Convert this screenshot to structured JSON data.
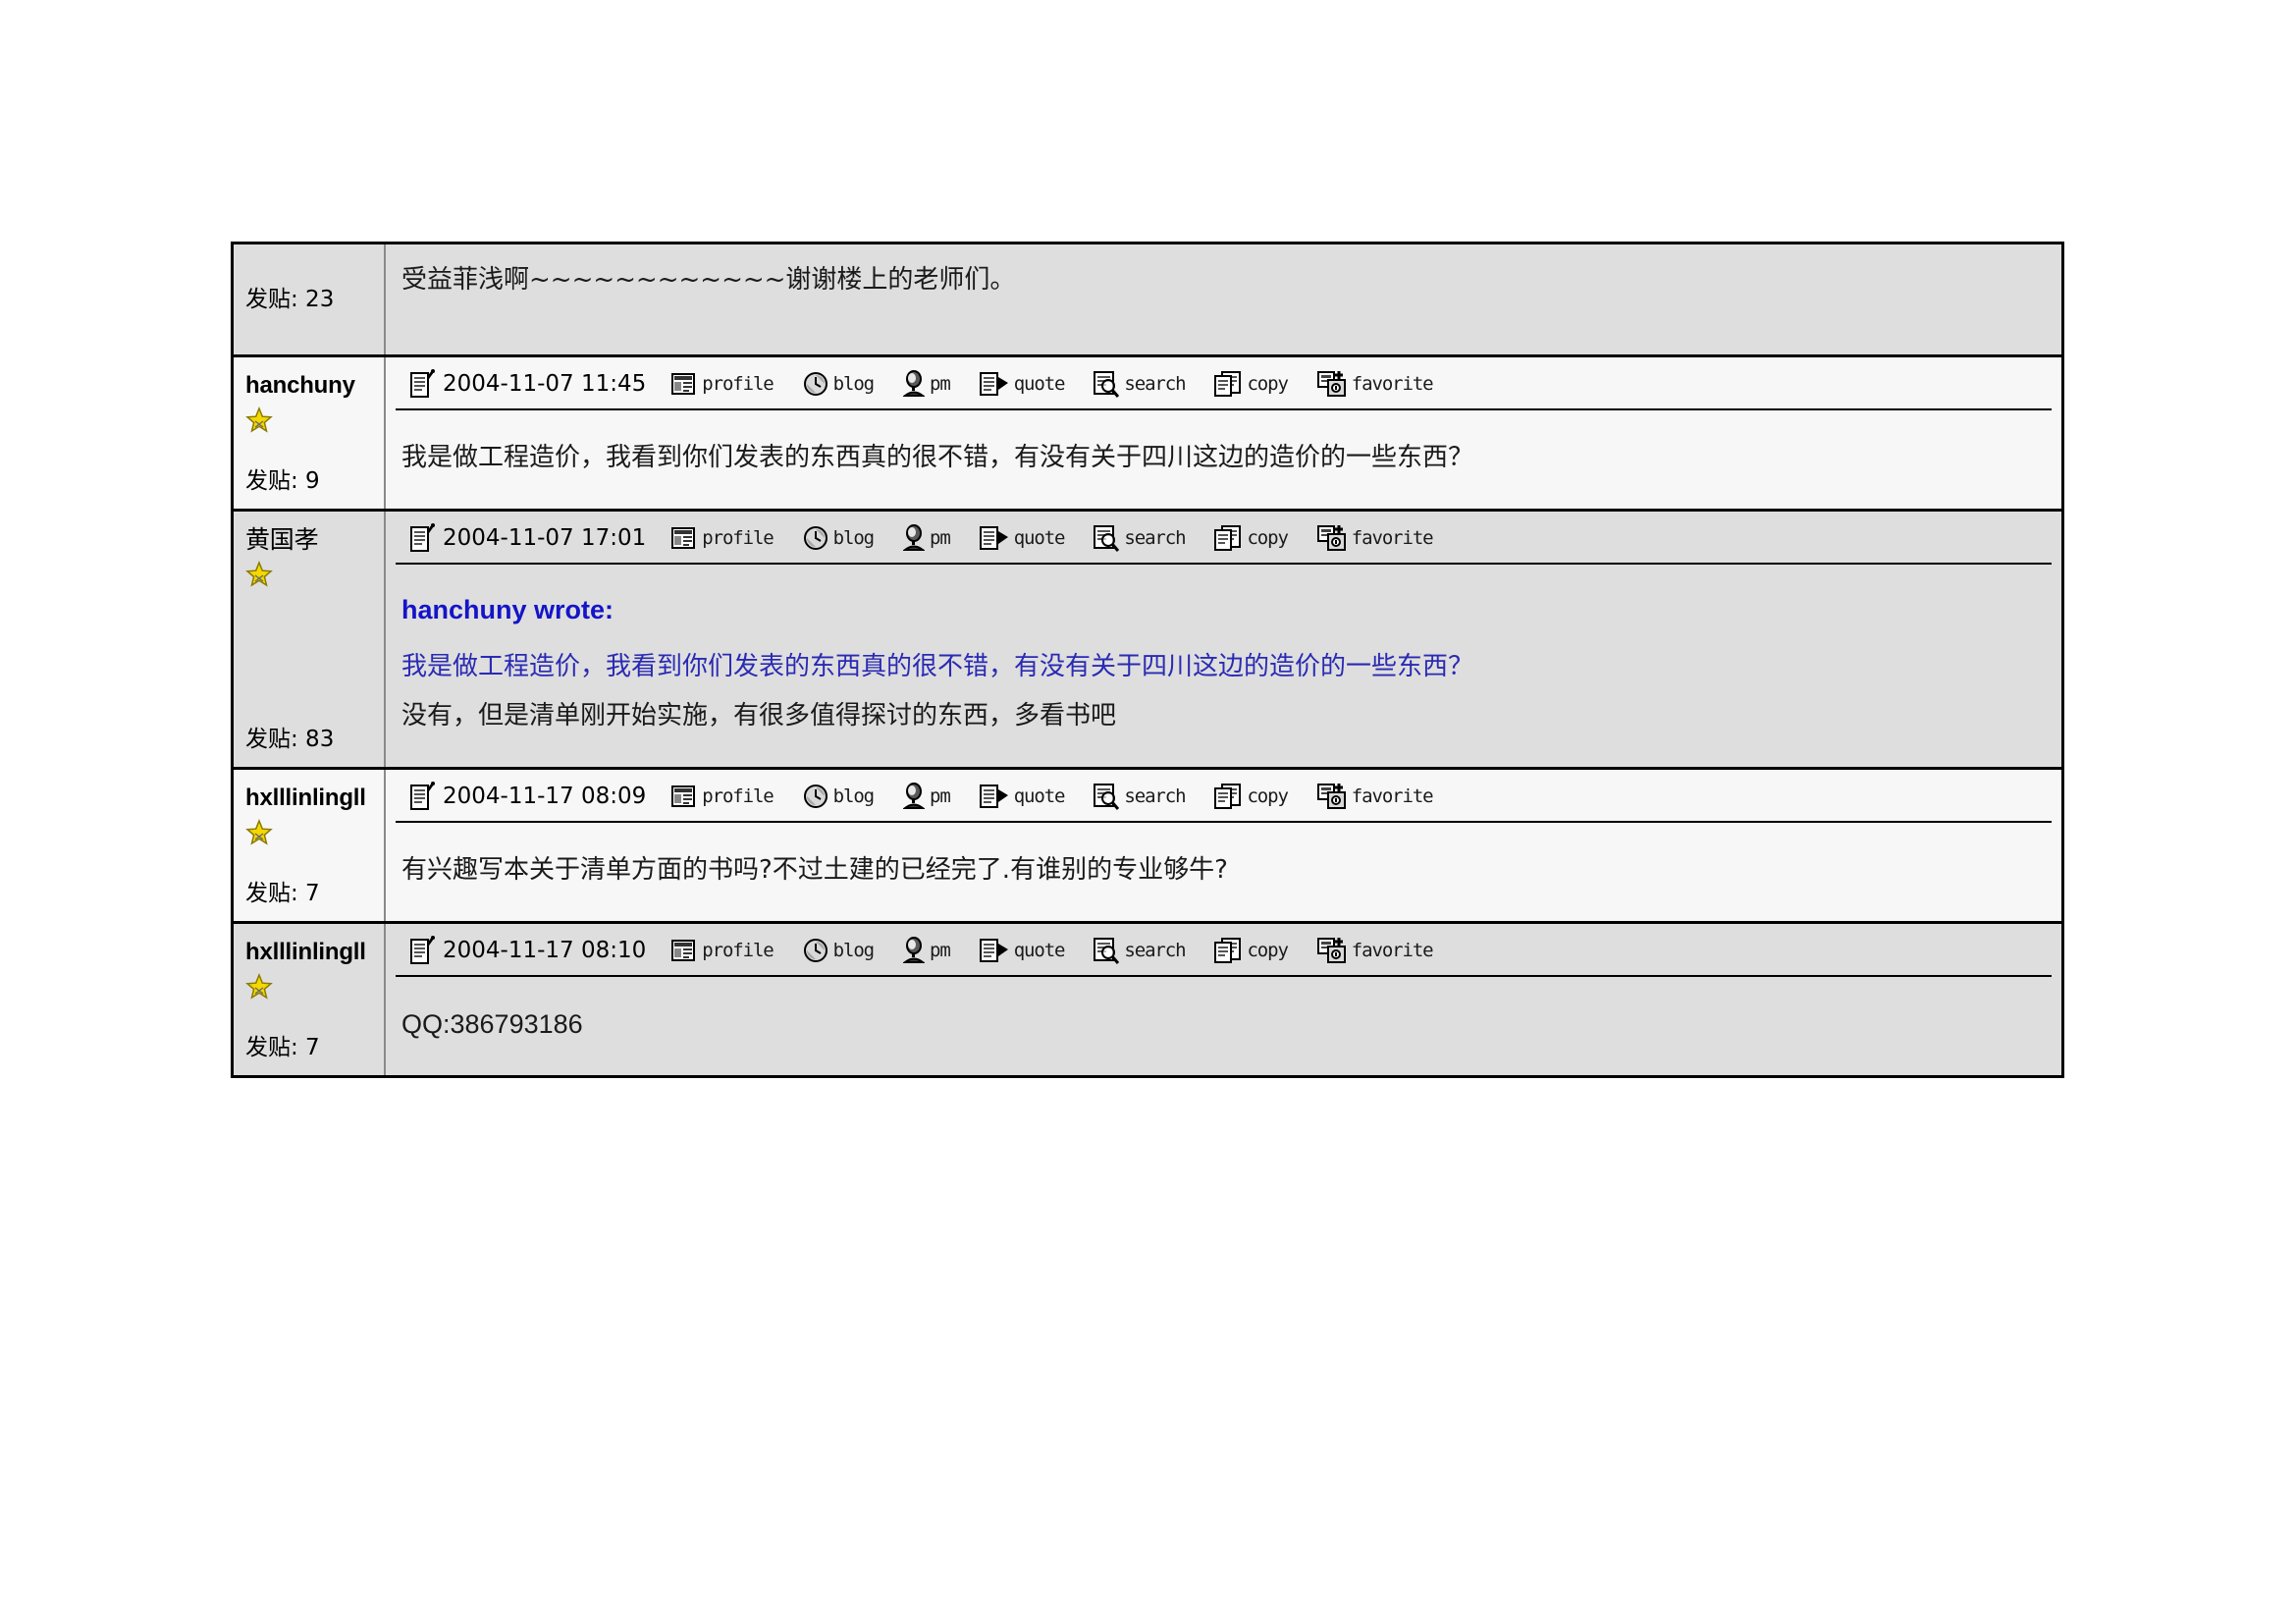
{
  "thread": {
    "icons": {
      "post_icon": "post-note-icon",
      "star": "star-badge-icon"
    },
    "toolbar_tools": [
      {
        "name": "profile",
        "label": "profile",
        "icon": "profile-icon"
      },
      {
        "name": "blog",
        "label": "blog",
        "icon": "blog-globe-icon"
      },
      {
        "name": "pm",
        "label": "pm",
        "icon": "pm-person-icon"
      },
      {
        "name": "quote",
        "label": "quote",
        "icon": "quote-icon"
      },
      {
        "name": "search",
        "label": "search",
        "icon": "search-magnifier-icon"
      },
      {
        "name": "copy",
        "label": "copy",
        "icon": "copy-pages-icon"
      },
      {
        "name": "favorite",
        "label": "favorite",
        "icon": "favorite-add-icon"
      }
    ],
    "posts": [
      {
        "author": "",
        "postcount_label": "发贴: 23",
        "date": "",
        "has_toolbar": false,
        "body_lines": [
          "受益菲浅啊~~~~~~~~~~~~谢谢楼上的老师们。"
        ],
        "quote": null
      },
      {
        "author": "hanchuny",
        "postcount_label": "发贴: 9",
        "date": "2004-11-07 11:45",
        "has_toolbar": true,
        "body_lines": [
          "我是做工程造价，我看到你们发表的东西真的很不错，有没有关于四川这边的造价的一些东西？"
        ],
        "quote": null
      },
      {
        "author": "黄国孝",
        "postcount_label": "发贴: 83",
        "date": "2004-11-07 17:01",
        "has_toolbar": true,
        "quote": {
          "head": "hanchuny wrote:",
          "text": "我是做工程造价，我看到你们发表的东西真的很不错，有没有关于四川这边的造价的一些东西？"
        },
        "body_lines": [
          "没有，但是清单刚开始实施，有很多值得探讨的东西，多看书吧"
        ]
      },
      {
        "author": "hxlllinlingll",
        "postcount_label": "发贴: 7",
        "date": "2004-11-17 08:09",
        "has_toolbar": true,
        "body_lines": [
          "有兴趣写本关于清单方面的书吗?不过土建的已经完了.有谁别的专业够牛?"
        ],
        "quote": null
      },
      {
        "author": "hxlllinlingll",
        "postcount_label": "发贴: 7",
        "date": "2004-11-17 08:10",
        "has_toolbar": true,
        "body_lines": [
          "QQ:386793186"
        ],
        "quote": null
      }
    ]
  },
  "colors": {
    "shade_a": "#dedede",
    "shade_b": "#f7f7f7",
    "border": "#000000",
    "quote_text": "#2a2ab4",
    "quote_head": "#1414c8",
    "star": "#f5d800"
  }
}
